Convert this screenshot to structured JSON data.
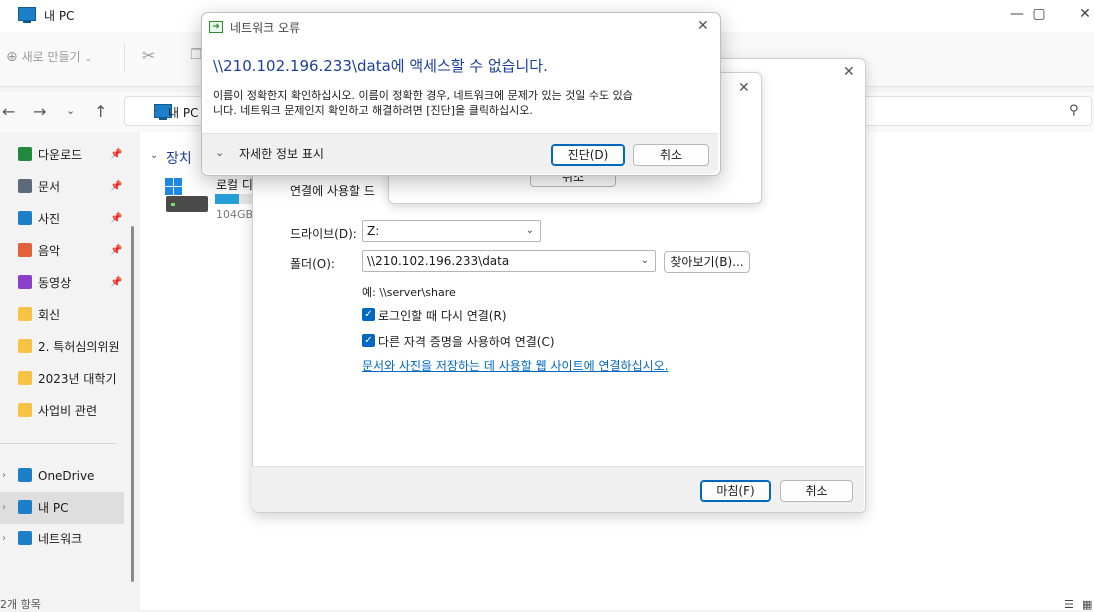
{
  "explorer": {
    "title": "내 PC",
    "toolbar": {
      "new_label": "새로 만들기"
    },
    "address": {
      "crumb": "내 PC"
    },
    "section_title": "장치",
    "drive": {
      "name": "로컬 디",
      "size": "104GB",
      "fill": 0.6
    },
    "sidebar": {
      "quick": [
        {
          "label": "다운로드",
          "icon": "download-icon",
          "color": "#1f8a3b"
        },
        {
          "label": "문서",
          "icon": "document-icon",
          "color": "#5b6b7b"
        },
        {
          "label": "사진",
          "icon": "pictures-icon",
          "color": "#1e7fc9"
        },
        {
          "label": "음악",
          "icon": "music-icon",
          "color": "#e2613b"
        },
        {
          "label": "동영상",
          "icon": "video-icon",
          "color": "#8b3ec7"
        },
        {
          "label": "회신",
          "icon": "folder-icon",
          "color": "#f6c343"
        },
        {
          "label": "2. 특허심의위원",
          "icon": "folder-icon",
          "color": "#f6c343"
        },
        {
          "label": "2023년 대학기",
          "icon": "folder-icon",
          "color": "#f6c343"
        },
        {
          "label": "사업비 관련",
          "icon": "folder-icon",
          "color": "#f6c343"
        }
      ],
      "roots": [
        {
          "label": "OneDrive",
          "icon": "cloud-icon",
          "color": "#1e7fc9"
        },
        {
          "label": "내 PC",
          "icon": "pc-icon",
          "color": "#1e7fc9"
        },
        {
          "label": "네트워크",
          "icon": "network-icon",
          "color": "#1e7fc9"
        }
      ]
    },
    "status": "2개 항목"
  },
  "wizard": {
    "partial_text": "연결에 사용할 드",
    "drive_label": "드라이브(D):",
    "drive_value": "Z:",
    "folder_label": "폴더(O):",
    "folder_value": "\\\\210.102.196.233\\data",
    "browse_label": "찾아보기(B)...",
    "example": "예: \\\\server\\share",
    "reconnect_label": "로그인할 때 다시 연결(R)",
    "credentials_label": "다른 자격 증명을 사용하여 연결(C)",
    "link_text": "문서와 사진을 저장하는 데 사용할 웹 사이트에 연결하십시오.",
    "finish_label": "마침(F)",
    "cancel_label": "취소"
  },
  "background_dialog": {
    "cancel_label": "취소"
  },
  "error_dialog": {
    "title": "네트워크 오류",
    "main_text": "\\\\210.102.196.233\\data에 액세스할 수 없습니다.",
    "body_line1": "이름이 정확한지 확인하십시오. 이름이 정확한 경우, 네트워크에 문제가 있는 것일 수도 있습",
    "body_line2": "니다. 네트워크 문제인지 확인하고 해결하려면 [진단]을 클릭하십시오.",
    "details_label": "자세한 정보 표시",
    "diagnose_label": "진단(D)",
    "cancel_label": "취소"
  }
}
